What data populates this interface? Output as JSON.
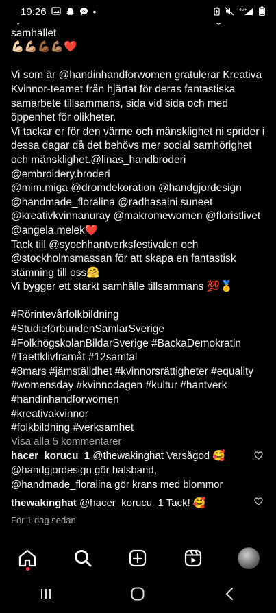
{
  "status_bar": {
    "time": "19:26",
    "dot": "•",
    "icons_left": [
      "gallery-icon",
      "snapchat-icon",
      "messenger-icon"
    ],
    "icons_right": [
      "battery-saver-icon",
      "mute-icon",
      "4g-signal-icon",
      "battery-icon"
    ]
  },
  "caption": {
    "partial_line": "nyanlända kvinnor arbetar vi för sociala integration i",
    "line2": "samhället",
    "emojis": "💪🏻💪🏼💪🏾💪🏽❤️",
    "body": "Vi som är @handinhandforwomen gratulerar Kreativa Kvinnor-teamet från hjärtat för deras fantastiska samarbete tillsammans, sida vid sida och med öppenhet för olikheter.\nVi tackar er för den värme och mänsklighet ni sprider i dessa dagar då det behövs mer social samhörighet och mänsklighet.@linas_handbroderi\n@embroidery.broderi\n@mim.miga @dromdekoration @handgjordesign\n@handmade_floralina @radhasaini.suneet\n@kreativkvinnanuray @makromewomen @floristlivet\n@angela.melek❤️\nTack till @syochhantverksfestivalen och @stockholmsmassan för att skapa en fantastisk stämning till oss🤗\nVi bygger ett starkt samhälle tillsammans 💯🥇",
    "hashtags": "#Rörintevårfolkbildning\n#StudieförbundenSamlarSverige\n#FolkhögskolanBildarSverige #BackaDemokratin\n#Taettklivframåt #12samtal\n#8mars #jämställdhet #kvinnorsrättigheter #equality\n#womensday #kvinnodagen #kultur #hantverk\n#handinhandforwomen\n#kreativakvinnor\n#folkbildning #verksamhet"
  },
  "view_comments": "Visa alla 5 kommentarer",
  "comments": [
    {
      "user": "hacer_korucu_1",
      "text": " @thewakinghat Varsågod 🥰 @handgjordesign gör halsband, @handmade_floralina gör krans med blommor"
    },
    {
      "user": "thewakinghat",
      "text": " @hacer_korucu_1 Tack! 🥰"
    }
  ],
  "timestamp": "För 1 dag sedan",
  "bottom_nav": [
    "home-icon",
    "search-icon",
    "create-icon",
    "reels-icon",
    "profile-avatar"
  ],
  "colors": {
    "background": "#000000",
    "text": "#f2f2f2",
    "muted": "#a8a8a8",
    "notification_dot": "#ff3040"
  }
}
